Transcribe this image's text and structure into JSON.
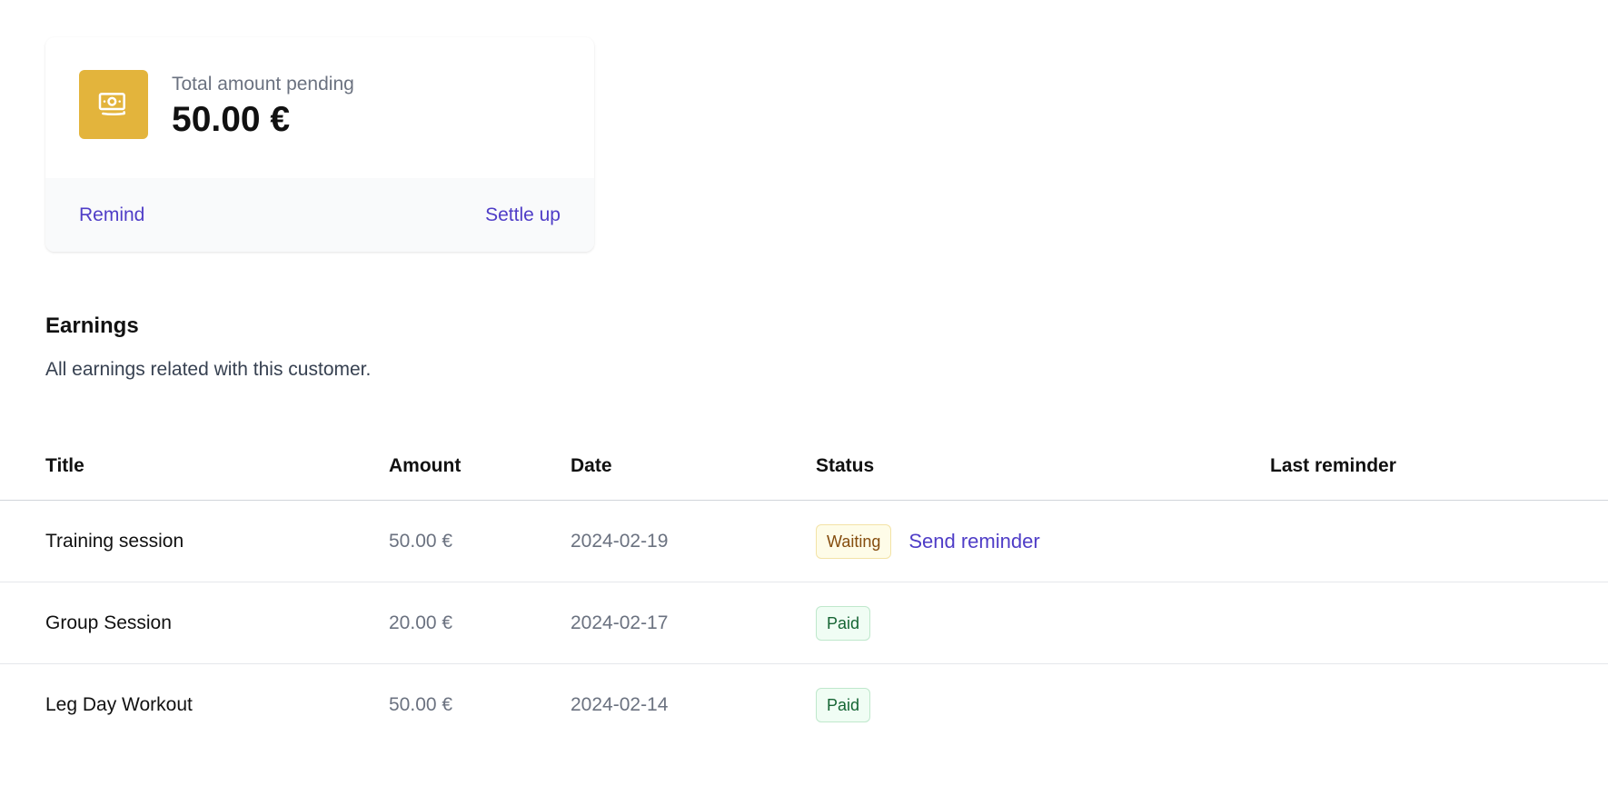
{
  "summary": {
    "icon": "banknotes-icon",
    "accent_color": "#e3b43c",
    "label": "Total amount pending",
    "value": "50.00 €",
    "remind_label": "Remind",
    "settle_label": "Settle up"
  },
  "earnings": {
    "title": "Earnings",
    "description": "All earnings related with this customer."
  },
  "table": {
    "headers": {
      "title": "Title",
      "amount": "Amount",
      "date": "Date",
      "status": "Status",
      "last_reminder": "Last reminder"
    },
    "rows": [
      {
        "title": "Training session",
        "amount": "50.00 €",
        "date": "2024-02-19",
        "status": "Waiting",
        "action": "Send reminder",
        "last_reminder": ""
      },
      {
        "title": "Group Session",
        "amount": "20.00 €",
        "date": "2024-02-17",
        "status": "Paid",
        "last_reminder": ""
      },
      {
        "title": "Leg Day Workout",
        "amount": "50.00 €",
        "date": "2024-02-14",
        "status": "Paid",
        "last_reminder": ""
      }
    ]
  },
  "colors": {
    "link": "#4f3dc7",
    "waiting_bg": "#fefce8",
    "waiting_text": "#854d0e",
    "paid_bg": "#f0fdf4",
    "paid_text": "#166534"
  }
}
